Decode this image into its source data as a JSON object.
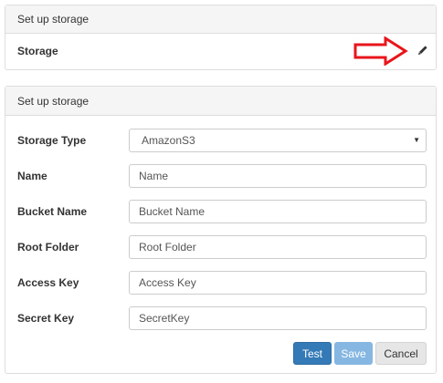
{
  "panel_top": {
    "heading": "Set up storage",
    "storage_label": "Storage",
    "edit_icon": "pencil-icon",
    "arrow_icon": "red-arrow-icon",
    "arrow_color": "#e8161b"
  },
  "panel_form": {
    "heading": "Set up storage",
    "storage_type": {
      "label": "Storage Type",
      "value": "AmazonS3"
    },
    "name": {
      "label": "Name",
      "placeholder": "Name"
    },
    "bucket_name": {
      "label": "Bucket Name",
      "placeholder": "Bucket Name"
    },
    "root_folder": {
      "label": "Root Folder",
      "placeholder": "Root Folder"
    },
    "access_key": {
      "label": "Access Key",
      "placeholder": "Access Key"
    },
    "secret_key": {
      "label": "Secret Key",
      "placeholder": "SecretKey"
    },
    "buttons": {
      "test": "Test",
      "save": "Save",
      "cancel": "Cancel"
    }
  },
  "colors": {
    "primary": "#337ab7",
    "primary_disabled": "#86b7e2",
    "default_button": "#e6e6e6",
    "panel_heading_bg": "#f5f5f5"
  }
}
